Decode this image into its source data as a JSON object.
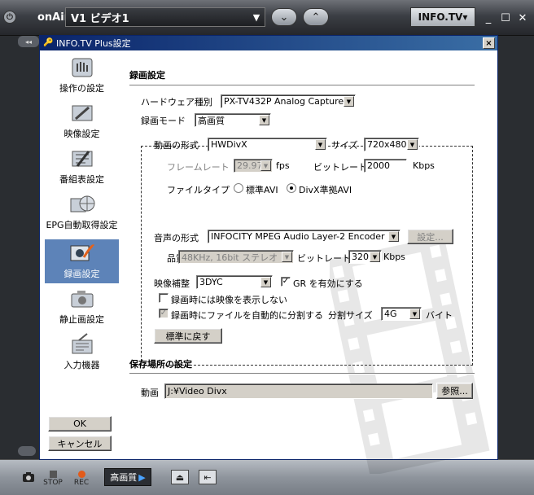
{
  "app": {
    "onair": "onAir",
    "channel": "V1 ビデオ1",
    "info_tv": "INFO.TV▾",
    "quality": "高画質",
    "stop": "STOP",
    "rec": "REC"
  },
  "dialog": {
    "title": "INFO.TV Plus設定",
    "close": "×"
  },
  "nav": [
    {
      "label": "操作の設定"
    },
    {
      "label": "映像設定"
    },
    {
      "label": "番組表設定"
    },
    {
      "label": "EPG自動取得設定"
    },
    {
      "label": "録画設定"
    },
    {
      "label": "静止画設定"
    },
    {
      "label": "入力機器"
    }
  ],
  "buttons": {
    "ok": "OK",
    "cancel": "キャンセル",
    "reset": "標準に戻す",
    "audio_settings": "設定...",
    "browse": "参照..."
  },
  "recording": {
    "section_title": "録画設定",
    "hardware_label": "ハードウェア種別",
    "hardware_value": "PX-TV432P Analog Capture",
    "mode_label": "録画モード",
    "mode_value": "高画質",
    "video_format_label": "動画の形式",
    "video_format_value": "HWDivX",
    "size_label": "サイズ",
    "size_value": "720x480",
    "framerate_label": "フレームレート",
    "framerate_value": "29.97",
    "fps_unit": "fps",
    "bitrate_label": "ビットレート",
    "bitrate_value": "2000",
    "kbps_unit": "Kbps",
    "filetype_label": "ファイルタイプ",
    "filetype_opt1": "標準AVI",
    "filetype_opt2": "DivX準拠AVI",
    "audio_format_label": "音声の形式",
    "audio_format_value": "INFOCITY MPEG Audio Layer-2 Encoder",
    "quality_label": "品質",
    "quality_value": "48KHz, 16bit ステレオ",
    "audio_bitrate_label": "ビットレート",
    "audio_bitrate_value": "320",
    "audio_kbps_unit": "Kbps",
    "video_correction_label": "映像補整",
    "video_correction_value": "3DYC",
    "gr_label": "GR を有効にする",
    "no_display_label": "録画時には映像を表示しない",
    "auto_split_label": "録画時にファイルを自動的に分割する",
    "split_size_label": "分割サイズ",
    "split_size_value": "4G",
    "byte_unit": "バイト"
  },
  "storage": {
    "section_title": "保存場所の設定",
    "video_label": "動画",
    "video_path": "J:¥Video Divx"
  }
}
